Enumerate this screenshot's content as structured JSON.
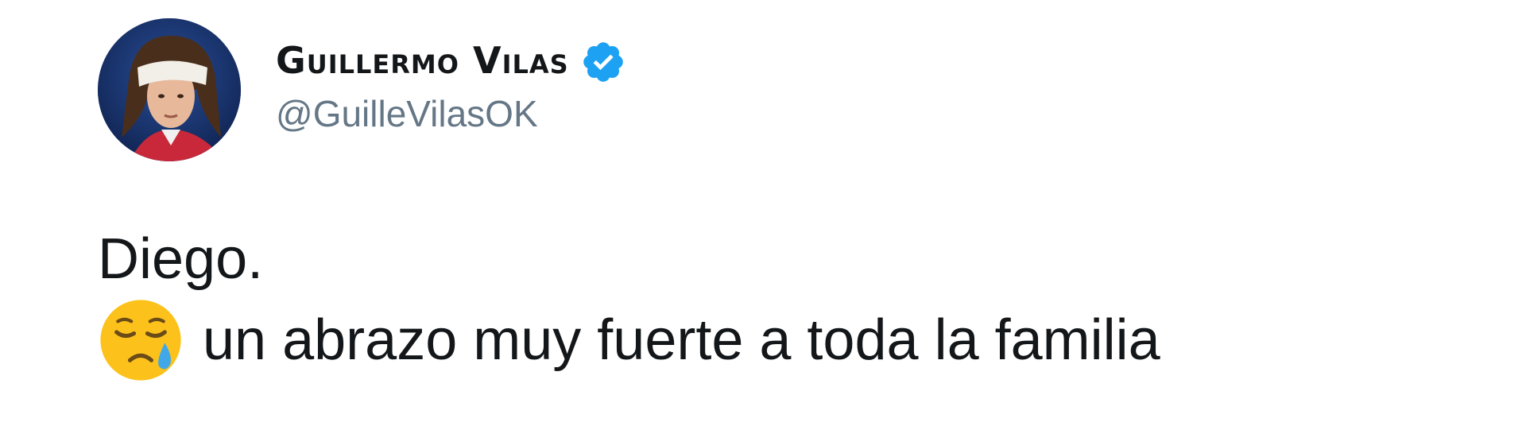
{
  "tweet": {
    "author": {
      "display_name": "Guillermo Vilas",
      "handle": "@GuilleVilasOK",
      "verified": true,
      "verified_icon": "verified-badge-icon",
      "verified_color": "#1da1f2"
    },
    "text": {
      "line1": "Diego.",
      "emoji": "sad-relieved-face-icon",
      "line2": "un abrazo muy fuerte a toda la familia"
    }
  }
}
